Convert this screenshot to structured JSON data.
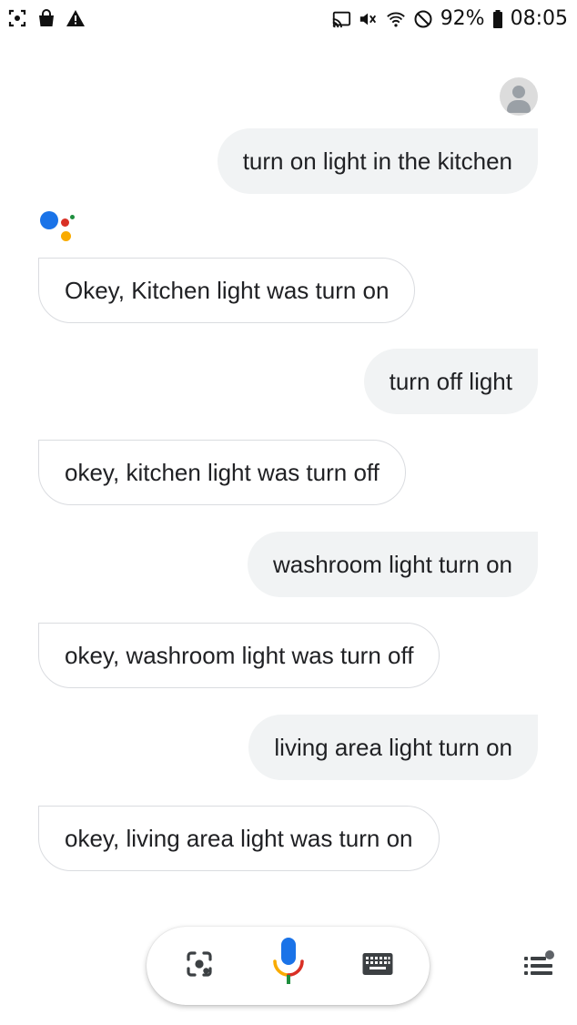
{
  "status_bar": {
    "left_icons": [
      "screenshot-icon",
      "shopping-bag-icon",
      "warning-icon"
    ],
    "right_icons": [
      "cast-icon",
      "mute-icon",
      "wifi-icon",
      "do-not-disturb-icon",
      "battery-icon"
    ],
    "battery": "92%",
    "time": "08:05"
  },
  "conversation": [
    {
      "role": "user",
      "text": "turn on light in the kitchen"
    },
    {
      "role": "assistant",
      "text": "Okey, Kitchen light was turn on"
    },
    {
      "role": "user",
      "text": "turn off light"
    },
    {
      "role": "assistant",
      "text": "okey, kitchen light was turn off"
    },
    {
      "role": "user",
      "text": "washroom light turn on"
    },
    {
      "role": "assistant",
      "text": "okey, washroom light was turn off"
    },
    {
      "role": "user",
      "text": "living area light turn on"
    },
    {
      "role": "assistant",
      "text": "okey, living area light was turn on"
    }
  ],
  "input_bar": {
    "buttons": [
      "lens-icon",
      "microphone-icon",
      "keyboard-icon"
    ]
  },
  "menu": {
    "icon": "updates-menu-icon"
  },
  "colors": {
    "user_bubble": "#f1f3f4",
    "assistant_border": "#dadce0",
    "google_blue": "#1a73e8",
    "google_red": "#d93025",
    "google_yellow": "#f9ab00",
    "google_green": "#1e8e3e"
  }
}
